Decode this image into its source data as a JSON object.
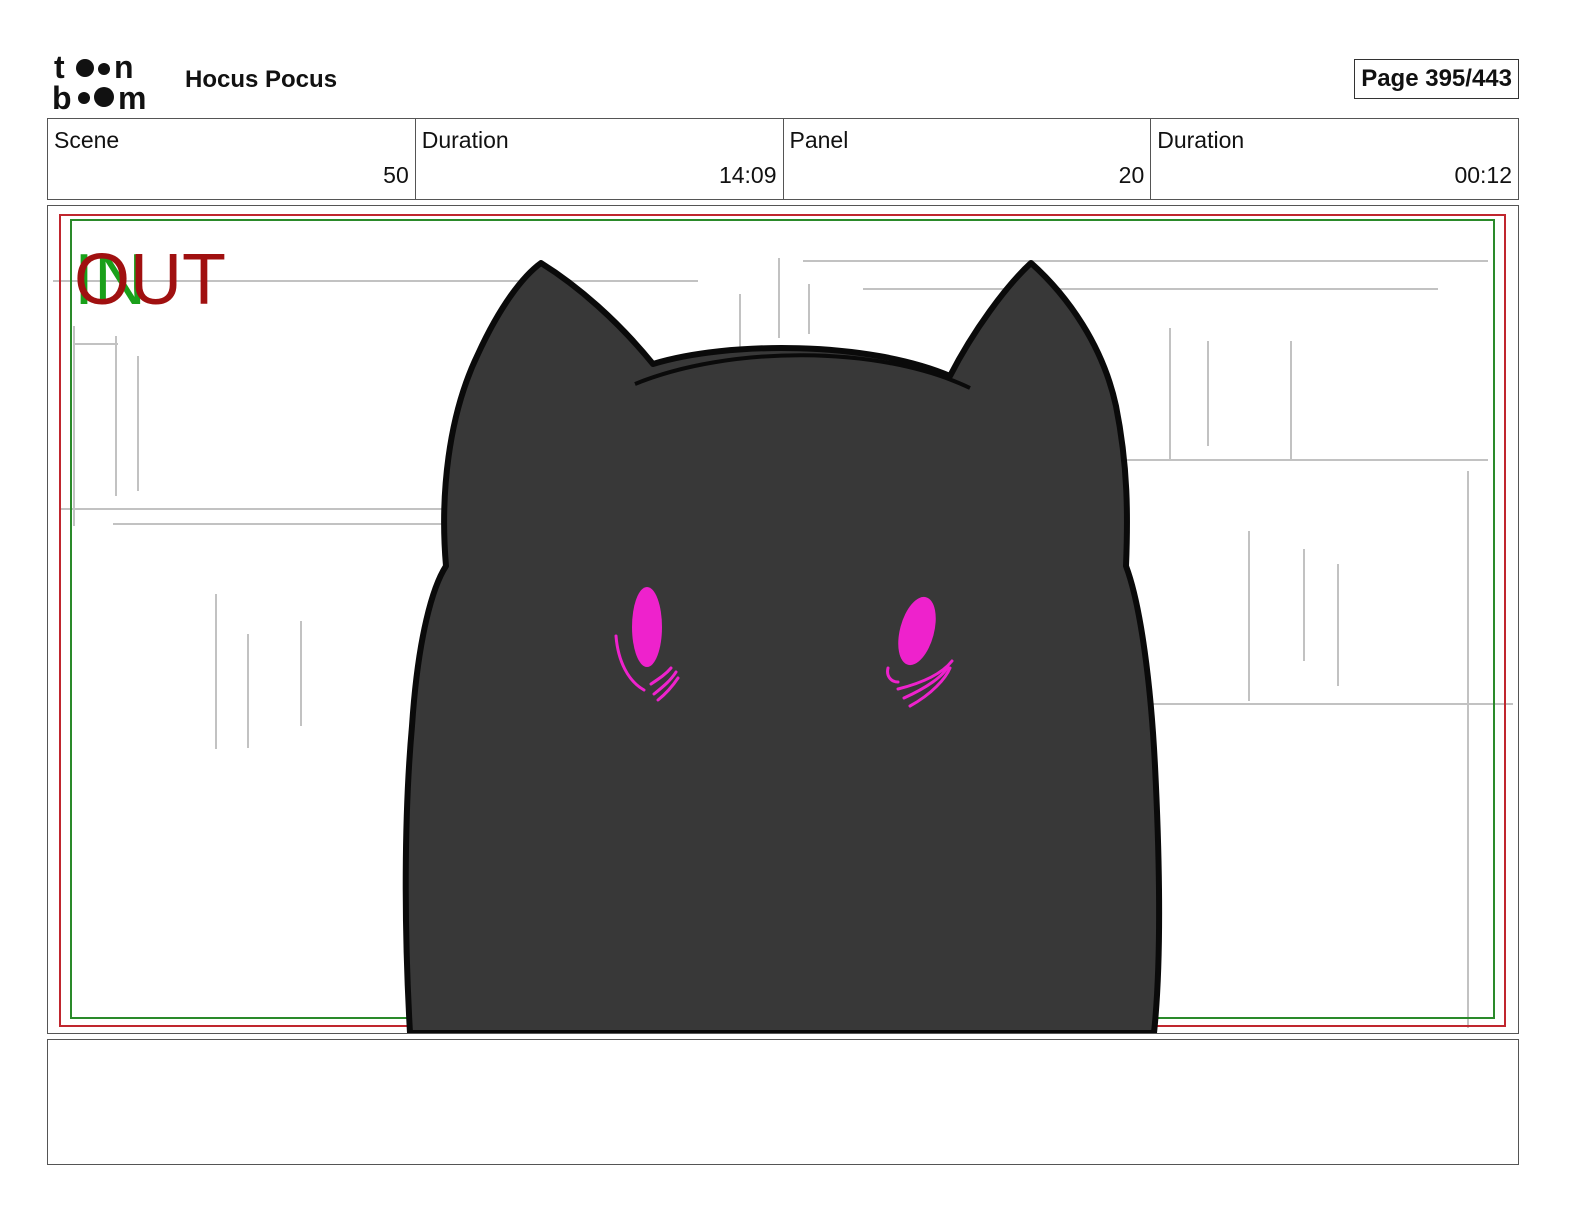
{
  "header": {
    "logo_text": "toon boom",
    "project_title": "Hocus Pocus",
    "page_label": "Page 395/443"
  },
  "info": [
    {
      "label": "Scene",
      "value": "50"
    },
    {
      "label": "Duration",
      "value": "14:09"
    },
    {
      "label": "Panel",
      "value": "20"
    },
    {
      "label": "Duration",
      "value": "00:12"
    }
  ],
  "panel": {
    "out_marker": "OUT",
    "in_marker": "IN",
    "colors": {
      "out_marker": "#a01010",
      "in_marker": "#1aa01a",
      "cat_body": "#383838",
      "cat_eyes": "#ee22cc",
      "sketch_lines": "#bfbfbf"
    }
  },
  "notes": {
    "text": ""
  }
}
